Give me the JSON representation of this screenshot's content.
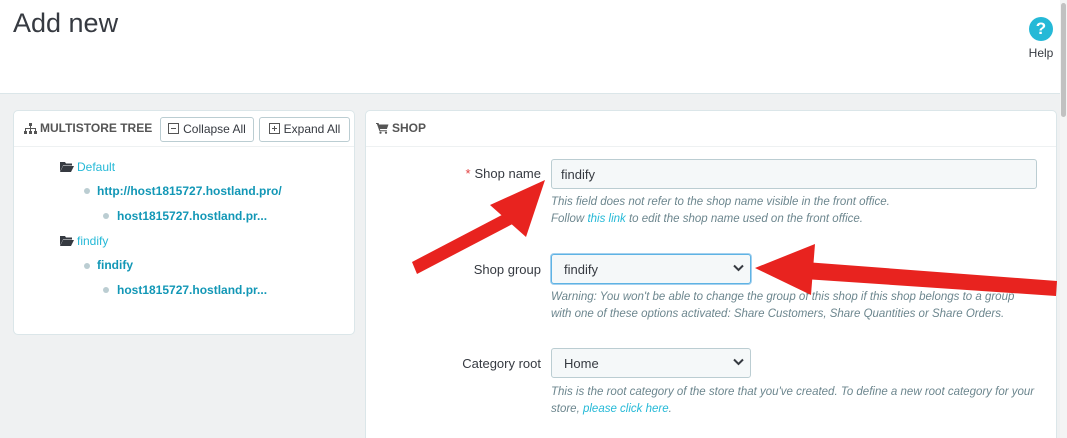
{
  "header": {
    "title": "Add new",
    "help_label": "Help"
  },
  "tree": {
    "heading": "MULTISTORE TREE",
    "collapse_label": "Collapse All",
    "expand_label": "Expand All",
    "items": [
      {
        "label": "Default"
      },
      {
        "label": "http://host1815727.hostland.pro/"
      },
      {
        "label": "host1815727.hostland.pr..."
      },
      {
        "label": "findify"
      },
      {
        "label": "findify"
      },
      {
        "label": "host1815727.hostland.pr..."
      }
    ]
  },
  "shop": {
    "heading": "SHOP",
    "name_label": "Shop name",
    "name_value": "findify",
    "name_help_1": "This field does not refer to the shop name visible in the front office.",
    "name_help_2_pre": "Follow ",
    "name_help_2_link": "this link",
    "name_help_2_post": " to edit the shop name used on the front office.",
    "group_label": "Shop group",
    "group_value": "findify",
    "group_help": "Warning: You won't be able to change the group of this shop if this shop belongs to a group with one of these options activated: Share Customers, Share Quantities or Share Orders.",
    "category_label": "Category root",
    "category_value": "Home",
    "category_help_pre": "This is the root category of the store that you've created. To define a new root category for your store, ",
    "category_help_link": "please click here",
    "category_help_post": "."
  },
  "colors": {
    "accent": "#25b9d7",
    "arrow": "#e8231f",
    "required": "#e24141"
  }
}
